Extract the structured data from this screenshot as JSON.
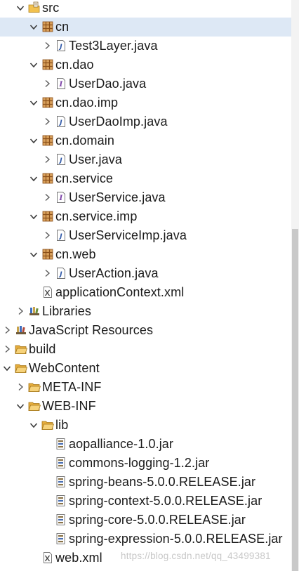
{
  "tree": {
    "items": [
      {
        "label": "src",
        "icon": "source-folder-icon",
        "expanded": true,
        "level": 1
      },
      {
        "label": "cn",
        "icon": "package-icon",
        "expanded": true,
        "level": 2,
        "selected": true
      },
      {
        "label": "Test3Layer.java",
        "icon": "java-file-icon",
        "expanded": false,
        "level": 3
      },
      {
        "label": "cn.dao",
        "icon": "package-icon",
        "expanded": true,
        "level": 2
      },
      {
        "label": "UserDao.java",
        "icon": "java-interface-file-icon",
        "expanded": false,
        "level": 3
      },
      {
        "label": "cn.dao.imp",
        "icon": "package-icon",
        "expanded": true,
        "level": 2
      },
      {
        "label": "UserDaoImp.java",
        "icon": "java-file-icon",
        "expanded": false,
        "level": 3
      },
      {
        "label": "cn.domain",
        "icon": "package-icon",
        "expanded": true,
        "level": 2
      },
      {
        "label": "User.java",
        "icon": "java-file-icon",
        "expanded": false,
        "level": 3
      },
      {
        "label": "cn.service",
        "icon": "package-icon",
        "expanded": true,
        "level": 2
      },
      {
        "label": "UserService.java",
        "icon": "java-interface-file-icon",
        "expanded": false,
        "level": 3
      },
      {
        "label": "cn.service.imp",
        "icon": "package-icon",
        "expanded": true,
        "level": 2
      },
      {
        "label": "UserServiceImp.java",
        "icon": "java-file-icon",
        "expanded": false,
        "level": 3
      },
      {
        "label": "cn.web",
        "icon": "package-icon",
        "expanded": true,
        "level": 2
      },
      {
        "label": "UserAction.java",
        "icon": "java-file-icon",
        "expanded": false,
        "level": 3
      },
      {
        "label": "applicationContext.xml",
        "icon": "xml-file-icon",
        "expanded": null,
        "level": 2
      },
      {
        "label": "Libraries",
        "icon": "libraries-icon",
        "expanded": false,
        "level": 1
      },
      {
        "label": "JavaScript Resources",
        "icon": "javascript-resources-icon",
        "expanded": false,
        "level": 0
      },
      {
        "label": "build",
        "icon": "folder-icon",
        "expanded": false,
        "level": 0
      },
      {
        "label": "WebContent",
        "icon": "folder-icon",
        "expanded": true,
        "level": 0
      },
      {
        "label": "META-INF",
        "icon": "folder-icon",
        "expanded": false,
        "level": 1
      },
      {
        "label": "WEB-INF",
        "icon": "folder-icon",
        "expanded": true,
        "level": 1
      },
      {
        "label": "lib",
        "icon": "folder-icon",
        "expanded": true,
        "level": 2
      },
      {
        "label": "aopalliance-1.0.jar",
        "icon": "jar-file-icon",
        "expanded": null,
        "level": 3
      },
      {
        "label": "commons-logging-1.2.jar",
        "icon": "jar-file-icon",
        "expanded": null,
        "level": 3
      },
      {
        "label": "spring-beans-5.0.0.RELEASE.jar",
        "icon": "jar-file-icon",
        "expanded": null,
        "level": 3
      },
      {
        "label": "spring-context-5.0.0.RELEASE.jar",
        "icon": "jar-file-icon",
        "expanded": null,
        "level": 3
      },
      {
        "label": "spring-core-5.0.0.RELEASE.jar",
        "icon": "jar-file-icon",
        "expanded": null,
        "level": 3
      },
      {
        "label": "spring-expression-5.0.0.RELEASE.jar",
        "icon": "jar-file-icon",
        "expanded": null,
        "level": 3
      },
      {
        "label": "web.xml",
        "icon": "xml-file-icon",
        "expanded": null,
        "level": 2
      }
    ]
  },
  "watermark": "https://blog.csdn.net/qq_43499381",
  "colors": {
    "selection": "#dde8f5",
    "package": "#a6642a",
    "folder": "#f2c14e",
    "java": "#2b55a6"
  }
}
